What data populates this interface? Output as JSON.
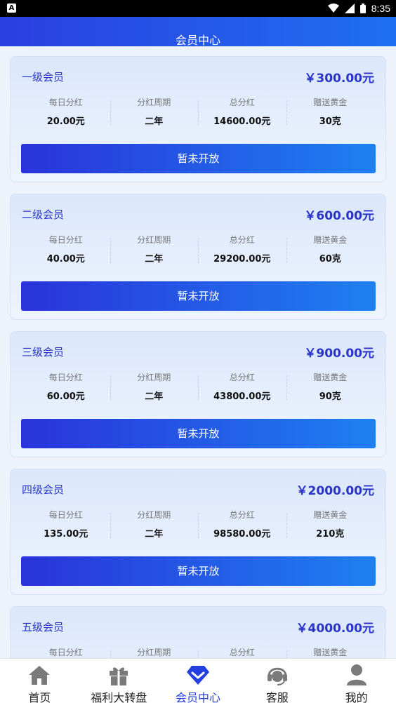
{
  "statusbar": {
    "time": "8:35",
    "badge": "A"
  },
  "header": {
    "title": "会员中心"
  },
  "stat_labels": {
    "daily": "每日分红",
    "period": "分红周期",
    "total": "总分红",
    "gold": "赠送黄金"
  },
  "cards": [
    {
      "name": "一级会员",
      "price": "￥300.00元",
      "daily": "20.00元",
      "period": "二年",
      "total": "14600.00元",
      "gold": "30克",
      "button": "暂未开放"
    },
    {
      "name": "二级会员",
      "price": "￥600.00元",
      "daily": "40.00元",
      "period": "二年",
      "total": "29200.00元",
      "gold": "60克",
      "button": "暂未开放"
    },
    {
      "name": "三级会员",
      "price": "￥900.00元",
      "daily": "60.00元",
      "period": "二年",
      "total": "43800.00元",
      "gold": "90克",
      "button": "暂未开放"
    },
    {
      "name": "四级会员",
      "price": "￥2000.00元",
      "daily": "135.00元",
      "period": "二年",
      "total": "98580.00元",
      "gold": "210克",
      "button": "暂未开放"
    },
    {
      "name": "五级会员",
      "price": "￥4000.00元",
      "daily": "",
      "period": "",
      "total": "",
      "gold": "",
      "button": ""
    }
  ],
  "tabs": [
    {
      "label": "首页",
      "icon": "home-icon",
      "active": false
    },
    {
      "label": "福利大转盘",
      "icon": "gift-icon",
      "active": false
    },
    {
      "label": "会员中心",
      "icon": "diamond-icon",
      "active": true
    },
    {
      "label": "客服",
      "icon": "headset-icon",
      "active": false
    },
    {
      "label": "我的",
      "icon": "user-icon",
      "active": false
    }
  ],
  "colors": {
    "accent": "#2440e0",
    "header_start": "#2b3fe0",
    "header_end": "#1f6ff0",
    "icon_gray": "#7a7a7a"
  }
}
